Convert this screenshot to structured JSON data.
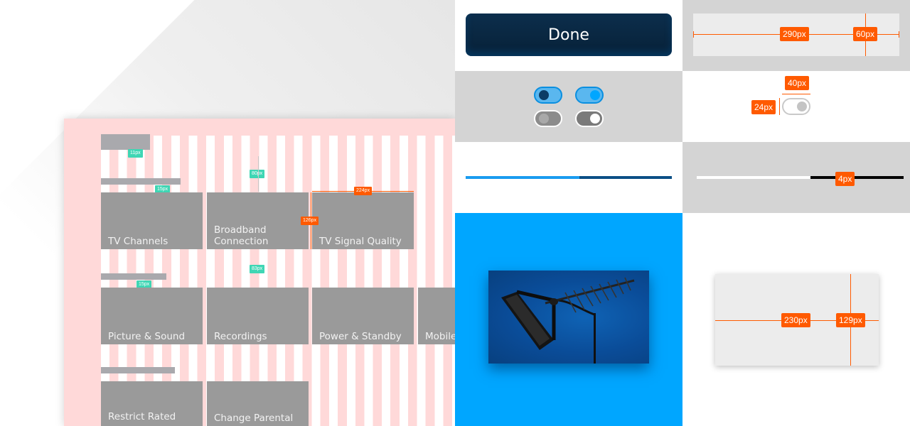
{
  "wireframe": {
    "tiles_row1": [
      "TV Channels",
      "Broadband\nConnection",
      "TV Signal Quality"
    ],
    "tiles_row2": [
      "Picture & Sound",
      "Recordings",
      "Power & Standby",
      "Mobile"
    ],
    "tiles_row3": [
      "Restrict Rated",
      "Change Parental"
    ],
    "measure_tags": {
      "t11": "11px",
      "t80": "80px",
      "t224": "224px",
      "t15a": "15px",
      "t126": "126px",
      "t15b": "15px",
      "t83": "83px"
    }
  },
  "button_spec": {
    "label": "Done",
    "width_label": "290px",
    "height_label": "60px"
  },
  "toggle_spec": {
    "width_label": "40px",
    "height_label": "24px"
  },
  "slider_spec": {
    "progress": 0.55,
    "thickness_label": "4px"
  },
  "image_spec": {
    "width_label": "230px",
    "height_label": "129px"
  },
  "colors": {
    "accent_orange": "#ff5a00",
    "teal_tag": "#3fd6b4",
    "button_navy": "#0c2e4c",
    "toggle_blue": "#00a6ff",
    "image_bg_blue": "#00a6ff"
  }
}
